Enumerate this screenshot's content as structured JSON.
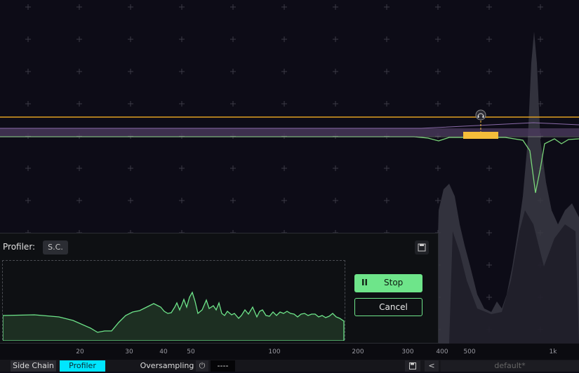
{
  "profiler": {
    "label": "Profiler:",
    "source": "S.C.",
    "stop_label": "Stop",
    "cancel_label": "Cancel"
  },
  "axis": {
    "ticks": [
      "20",
      "30",
      "40",
      "50",
      "100",
      "200",
      "300",
      "400",
      "500",
      "1k"
    ]
  },
  "bottom_bar": {
    "side_chain": "Side Chain",
    "profiler": "Profiler",
    "oversampling": "Oversampling",
    "oversampling_value": "----",
    "preset": "default*",
    "back": "<"
  },
  "colors": {
    "accent_cyan": "#00e5ff",
    "profile_green": "#6ee58a",
    "threshold_orange": "#f0b030"
  }
}
